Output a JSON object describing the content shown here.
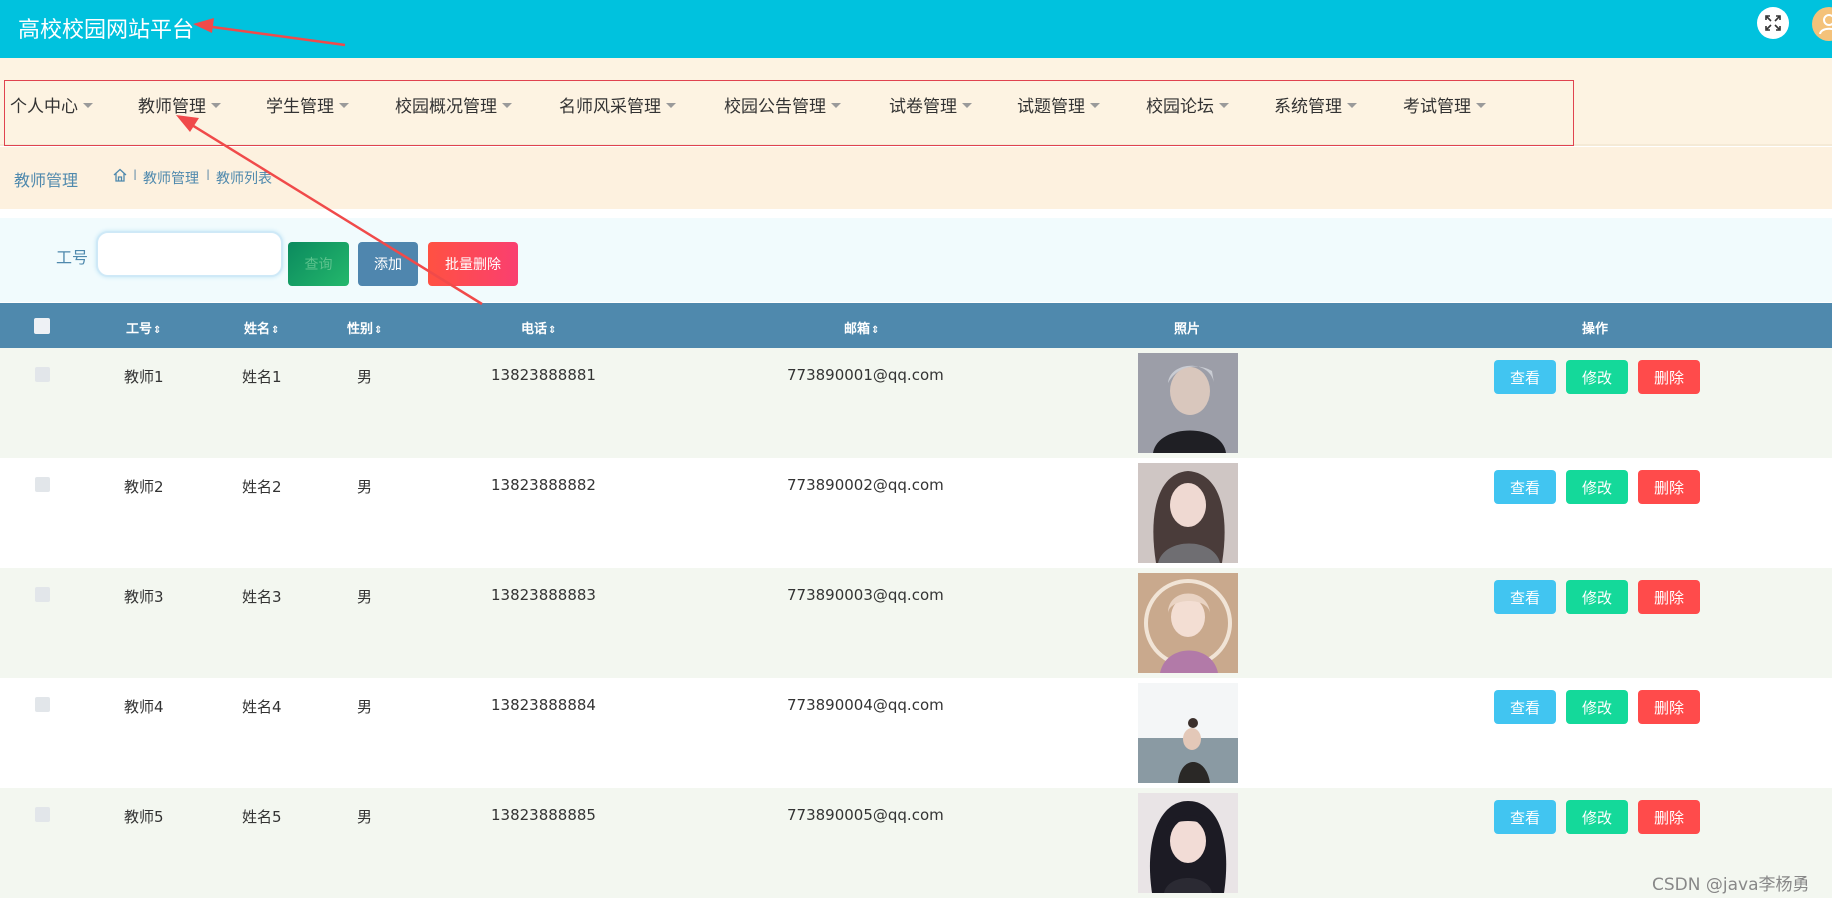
{
  "header": {
    "title": "高校校园网站平台",
    "fullscreen_icon": "expand-icon",
    "avatar_icon": "user-icon",
    "bg_color": "#00c2de"
  },
  "nav": {
    "items": [
      {
        "label": "个人中心"
      },
      {
        "label": "教师管理"
      },
      {
        "label": "学生管理"
      },
      {
        "label": "校园概况管理"
      },
      {
        "label": "名师风采管理"
      },
      {
        "label": "校园公告管理"
      },
      {
        "label": "试卷管理"
      },
      {
        "label": "试题管理"
      },
      {
        "label": "校园论坛"
      },
      {
        "label": "系统管理"
      },
      {
        "label": "考试管理"
      }
    ]
  },
  "breadcrumb": {
    "page_title": "教师管理",
    "home_icon": "home-icon",
    "items": [
      "教师管理",
      "教师列表"
    ],
    "separator": "I"
  },
  "search": {
    "label": "工号",
    "input_value": "",
    "search_label": "查询",
    "add_label": "添加",
    "batch_delete_label": "批量删除"
  },
  "table": {
    "columns": [
      "工号",
      "姓名",
      "性别",
      "电话",
      "邮箱",
      "照片",
      "操作"
    ],
    "rows": [
      {
        "id": "教师1",
        "name": "姓名1",
        "gender": "男",
        "phone": "13823888881",
        "email": "773890001@qq.com"
      },
      {
        "id": "教师2",
        "name": "姓名2",
        "gender": "男",
        "phone": "13823888882",
        "email": "773890002@qq.com"
      },
      {
        "id": "教师3",
        "name": "姓名3",
        "gender": "男",
        "phone": "13823888883",
        "email": "773890003@qq.com"
      },
      {
        "id": "教师4",
        "name": "姓名4",
        "gender": "男",
        "phone": "13823888884",
        "email": "773890004@qq.com"
      },
      {
        "id": "教师5",
        "name": "姓名5",
        "gender": "男",
        "phone": "13823888885",
        "email": "773890005@qq.com"
      }
    ],
    "actions": {
      "view": "查看",
      "edit": "修改",
      "delete": "删除"
    },
    "header_bg": "#4f89ad"
  },
  "watermark": "CSDN @java李杨勇"
}
